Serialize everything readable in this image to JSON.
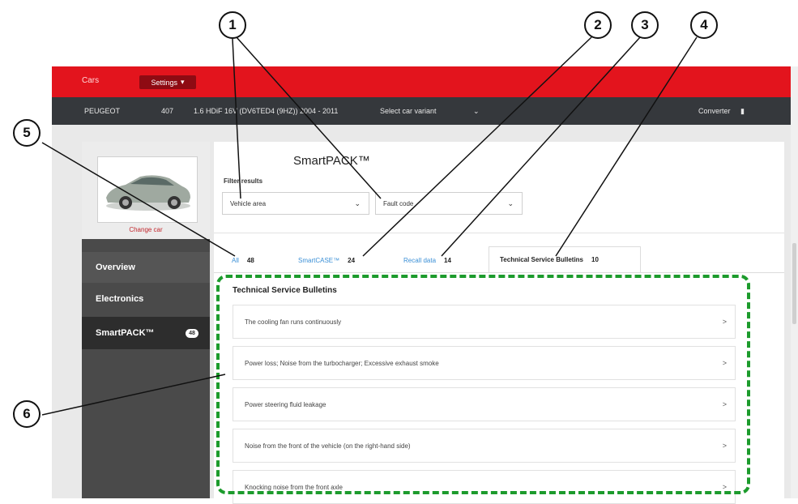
{
  "topbar": {
    "cars_tab": "Cars",
    "settings_label": "Settings"
  },
  "vehicle_bar": {
    "make": "PEUGEOT",
    "model": "407",
    "engine": "1.6 HDiF 16V (DV6TED4 (9HZ)) 2004 - 2011",
    "variant_select": "Select car variant",
    "converter": "Converter"
  },
  "sidebar": {
    "change_car": "Change car",
    "items": [
      {
        "label": "Overview"
      },
      {
        "label": "Electronics"
      },
      {
        "label": "SmartPACK™",
        "badge": "48"
      }
    ]
  },
  "main": {
    "title": "SmartPACK™",
    "filter_label": "Filter results",
    "filters": [
      {
        "value": "Vehicle area"
      },
      {
        "value": "Fault code"
      }
    ],
    "tabs": [
      {
        "label": "All",
        "count": "48"
      },
      {
        "label": "SmartCASE™",
        "count": "24"
      },
      {
        "label": "Recall data",
        "count": "14"
      },
      {
        "label": "Technical Service Bulletins",
        "count": "10"
      }
    ],
    "list_heading": "Technical Service Bulletins",
    "bulletins": [
      "The cooling fan runs continuously",
      "Power loss; Noise from the turbocharger; Excessive exhaust smoke",
      "Power steering fluid leakage",
      "Noise from the front of the vehicle (on the right-hand side)",
      "Knocking noise from the front axle"
    ],
    "row_arrow": ">"
  },
  "callouts": [
    "1",
    "2",
    "3",
    "4",
    "5",
    "6"
  ],
  "colors": {
    "brand_red": "#e3141d",
    "dark_bar": "#35383c",
    "highlight_green": "#1c9b2c",
    "link_blue": "#3a8fd6"
  },
  "icons": {
    "dropdown": "chevron-down-icon",
    "converter": "battery-icon",
    "row": "chevron-right-icon"
  }
}
